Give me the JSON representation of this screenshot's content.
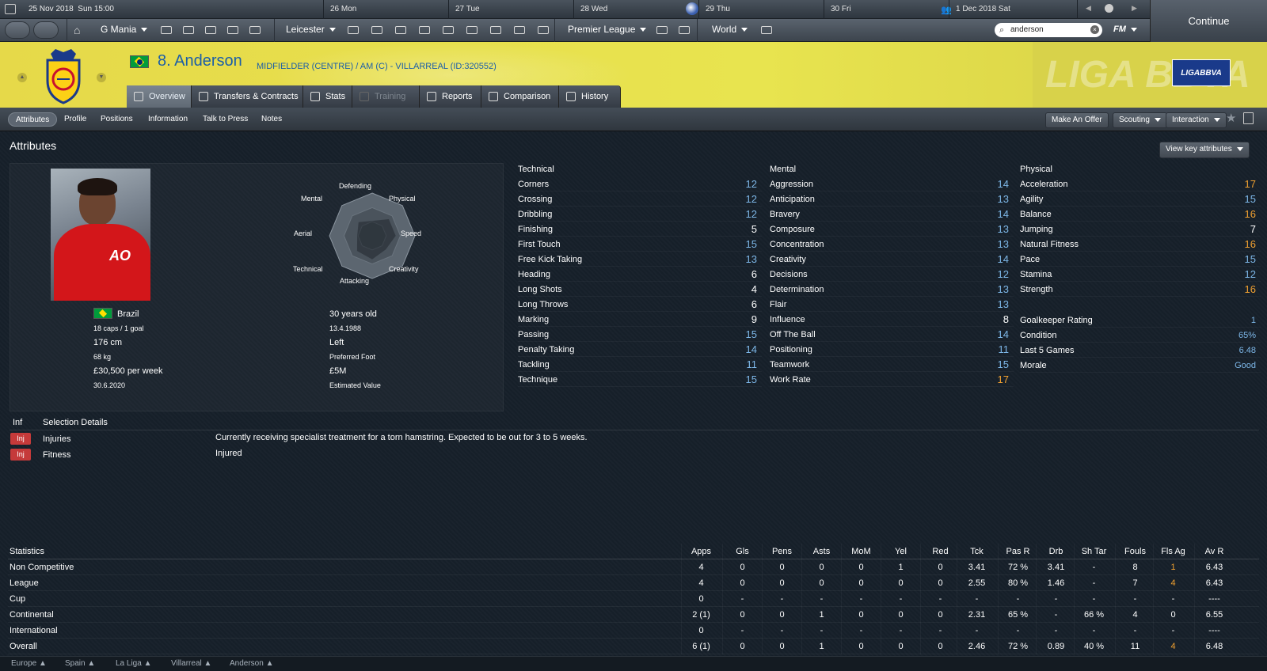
{
  "topbar": {
    "date": "25 Nov 2018",
    "day_time": "Sun 15:00",
    "cal": [
      "26  Mon",
      "27  Tue",
      "28  Wed",
      "29  Thu",
      "30  Fri",
      "1 Dec 2018  Sat"
    ],
    "continue": "Continue"
  },
  "nav": {
    "manager": "G Mania",
    "club": "Leicester",
    "competition": "Premier League",
    "world": "World",
    "search": "anderson",
    "fm": "FM"
  },
  "player": {
    "number_name": "8. Anderson",
    "subtitle": "MIDFIELDER (CENTRE) / AM (C) - VILLARREAL (ID:320552)",
    "league_badge": "LIGABBVA",
    "league_bg_text": "LIGA BBVA"
  },
  "tabs": [
    "Overview",
    "Transfers & Contracts",
    "Stats",
    "Training",
    "Reports",
    "Comparison",
    "History"
  ],
  "subtabs": [
    "Attributes",
    "Profile",
    "Positions",
    "Information",
    "Talk to Press",
    "Notes"
  ],
  "actions": {
    "offer": "Make An Offer",
    "scouting": "Scouting",
    "interaction": "Interaction",
    "view_key": "View key attributes"
  },
  "section_title": "Attributes",
  "radar": {
    "labels": [
      "Defending",
      "Physical",
      "Speed",
      "Creativity",
      "Attacking",
      "Technical",
      "Aerial",
      "Mental"
    ],
    "values": [
      0.35,
      0.55,
      0.55,
      0.45,
      0.55,
      0.5,
      0.35,
      0.45
    ]
  },
  "profile": {
    "nation": "Brazil",
    "caps": "18 caps / 1 goal",
    "height": "176 cm",
    "weight": "68 kg",
    "wage": "£30,500 per week",
    "contract": "30.6.2020",
    "age": "30 years old",
    "dob": "13.4.1988",
    "foot": "Left",
    "foot_label": "Preferred Foot",
    "value": "£5M",
    "value_label": "Estimated Value"
  },
  "technical": {
    "title": "Technical",
    "rows": [
      [
        "Corners",
        "12"
      ],
      [
        "Crossing",
        "12"
      ],
      [
        "Dribbling",
        "12"
      ],
      [
        "Finishing",
        "5"
      ],
      [
        "First Touch",
        "15"
      ],
      [
        "Free Kick Taking",
        "13"
      ],
      [
        "Heading",
        "6"
      ],
      [
        "Long Shots",
        "4"
      ],
      [
        "Long Throws",
        "6"
      ],
      [
        "Marking",
        "9"
      ],
      [
        "Passing",
        "15"
      ],
      [
        "Penalty Taking",
        "14"
      ],
      [
        "Tackling",
        "11"
      ],
      [
        "Technique",
        "15"
      ]
    ]
  },
  "mental": {
    "title": "Mental",
    "rows": [
      [
        "Aggression",
        "14"
      ],
      [
        "Anticipation",
        "13"
      ],
      [
        "Bravery",
        "14"
      ],
      [
        "Composure",
        "13"
      ],
      [
        "Concentration",
        "13"
      ],
      [
        "Creativity",
        "14"
      ],
      [
        "Decisions",
        "12"
      ],
      [
        "Determination",
        "13"
      ],
      [
        "Flair",
        "13"
      ],
      [
        "Influence",
        "8"
      ],
      [
        "Off The Ball",
        "14"
      ],
      [
        "Positioning",
        "11"
      ],
      [
        "Teamwork",
        "15"
      ],
      [
        "Work Rate",
        "17"
      ]
    ]
  },
  "physical": {
    "title": "Physical",
    "rows": [
      [
        "Acceleration",
        "17"
      ],
      [
        "Agility",
        "15"
      ],
      [
        "Balance",
        "16"
      ],
      [
        "Jumping",
        "7"
      ],
      [
        "Natural Fitness",
        "16"
      ],
      [
        "Pace",
        "15"
      ],
      [
        "Stamina",
        "12"
      ],
      [
        "Strength",
        "16"
      ]
    ],
    "extra": [
      [
        "Goalkeeper Rating",
        "1"
      ],
      [
        "Condition",
        "65%"
      ],
      [
        "Last 5 Games",
        "6.48"
      ],
      [
        "Morale",
        "Good"
      ]
    ]
  },
  "colors": {
    "white": "#ffffff",
    "blue": "#7db7e8",
    "orange": "#f0a030",
    "header_yellow": "#e8e44f",
    "name_blue": "#1b5ea8",
    "inj_red": "#c53a3a"
  },
  "selection": {
    "col1": "Inf",
    "col2": "Selection Details",
    "rows": [
      {
        "badge": "Inj",
        "label": "Injuries",
        "detail": "Currently receiving specialist treatment for a torn hamstring. Expected to be out for 3 to 5 weeks."
      },
      {
        "badge": "Inj",
        "label": "Fitness",
        "detail": "Injured"
      }
    ]
  },
  "stats": {
    "headers": [
      "Statistics",
      "Apps",
      "Gls",
      "Pens",
      "Asts",
      "MoM",
      "Yel",
      "Red",
      "Tck",
      "Pas R",
      "Drb",
      "Sh Tar",
      "Fouls",
      "Fls Ag",
      "Av R"
    ],
    "rows": [
      [
        "Non Competitive",
        "4",
        "0",
        "0",
        "0",
        "0",
        "1",
        "0",
        "3.41",
        "72 %",
        "3.41",
        "-",
        "8",
        "1",
        "6.43"
      ],
      [
        "League",
        "4",
        "0",
        "0",
        "0",
        "0",
        "0",
        "0",
        "2.55",
        "80 %",
        "1.46",
        "-",
        "7",
        "4",
        "6.43"
      ],
      [
        "Cup",
        "0",
        "-",
        "-",
        "-",
        "-",
        "-",
        "-",
        "-",
        "-",
        "-",
        "-",
        "-",
        "-",
        "----"
      ],
      [
        "Continental",
        "2 (1)",
        "0",
        "0",
        "1",
        "0",
        "0",
        "0",
        "2.31",
        "65 %",
        "-",
        "66 %",
        "4",
        "0",
        "6.55"
      ],
      [
        "International",
        "0",
        "-",
        "-",
        "-",
        "-",
        "-",
        "-",
        "-",
        "-",
        "-",
        "-",
        "-",
        "-",
        "----"
      ],
      [
        "Overall",
        "6 (1)",
        "0",
        "0",
        "1",
        "0",
        "0",
        "0",
        "2.46",
        "72 %",
        "0.89",
        "40 %",
        "11",
        "4",
        "6.48"
      ]
    ]
  },
  "breadcrumb": [
    "Europe",
    "Spain",
    "La Liga",
    "Villarreal",
    "Anderson"
  ]
}
